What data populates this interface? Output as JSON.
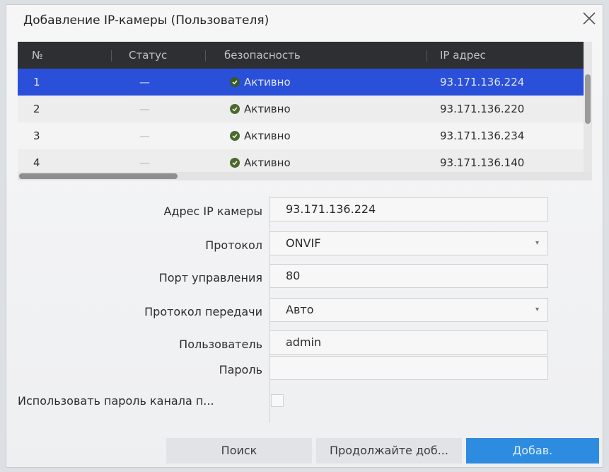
{
  "dialog": {
    "title": "Добавление IP-камеры (Пользователя)"
  },
  "table": {
    "headers": [
      "№",
      "Статус",
      "безопасность",
      "IP адрес"
    ],
    "rows": [
      {
        "num": "1",
        "status": "—",
        "security": "Активно",
        "ip": "93.171.136.224",
        "selected": true
      },
      {
        "num": "2",
        "status": "—",
        "security": "Активно",
        "ip": "93.171.136.220",
        "selected": false
      },
      {
        "num": "3",
        "status": "—",
        "security": "Активно",
        "ip": "93.171.136.234",
        "selected": false
      },
      {
        "num": "4",
        "status": "—",
        "security": "Активно",
        "ip": "93.171.136.140",
        "selected": false
      }
    ]
  },
  "form": {
    "ip_label": "Адрес IP камеры",
    "ip_value": "93.171.136.224",
    "protocol_label": "Протокол",
    "protocol_value": "ONVIF",
    "port_label": "Порт управления",
    "port_value": "80",
    "transfer_label": "Протокол передачи",
    "transfer_value": "Авто",
    "user_label": "Пользователь",
    "user_value": "admin",
    "password_label": "Пароль",
    "password_value": "",
    "use_channel_password_label": "Использовать пароль канала п..."
  },
  "buttons": {
    "search": "Поиск",
    "continue": "Продолжайте доб...",
    "add": "Добав."
  },
  "colors": {
    "header_bg": "#2e2f33",
    "selected_row": "#2a4fd8",
    "add_button": "#2e8ce0",
    "status_ok": "#4c6a2d"
  }
}
